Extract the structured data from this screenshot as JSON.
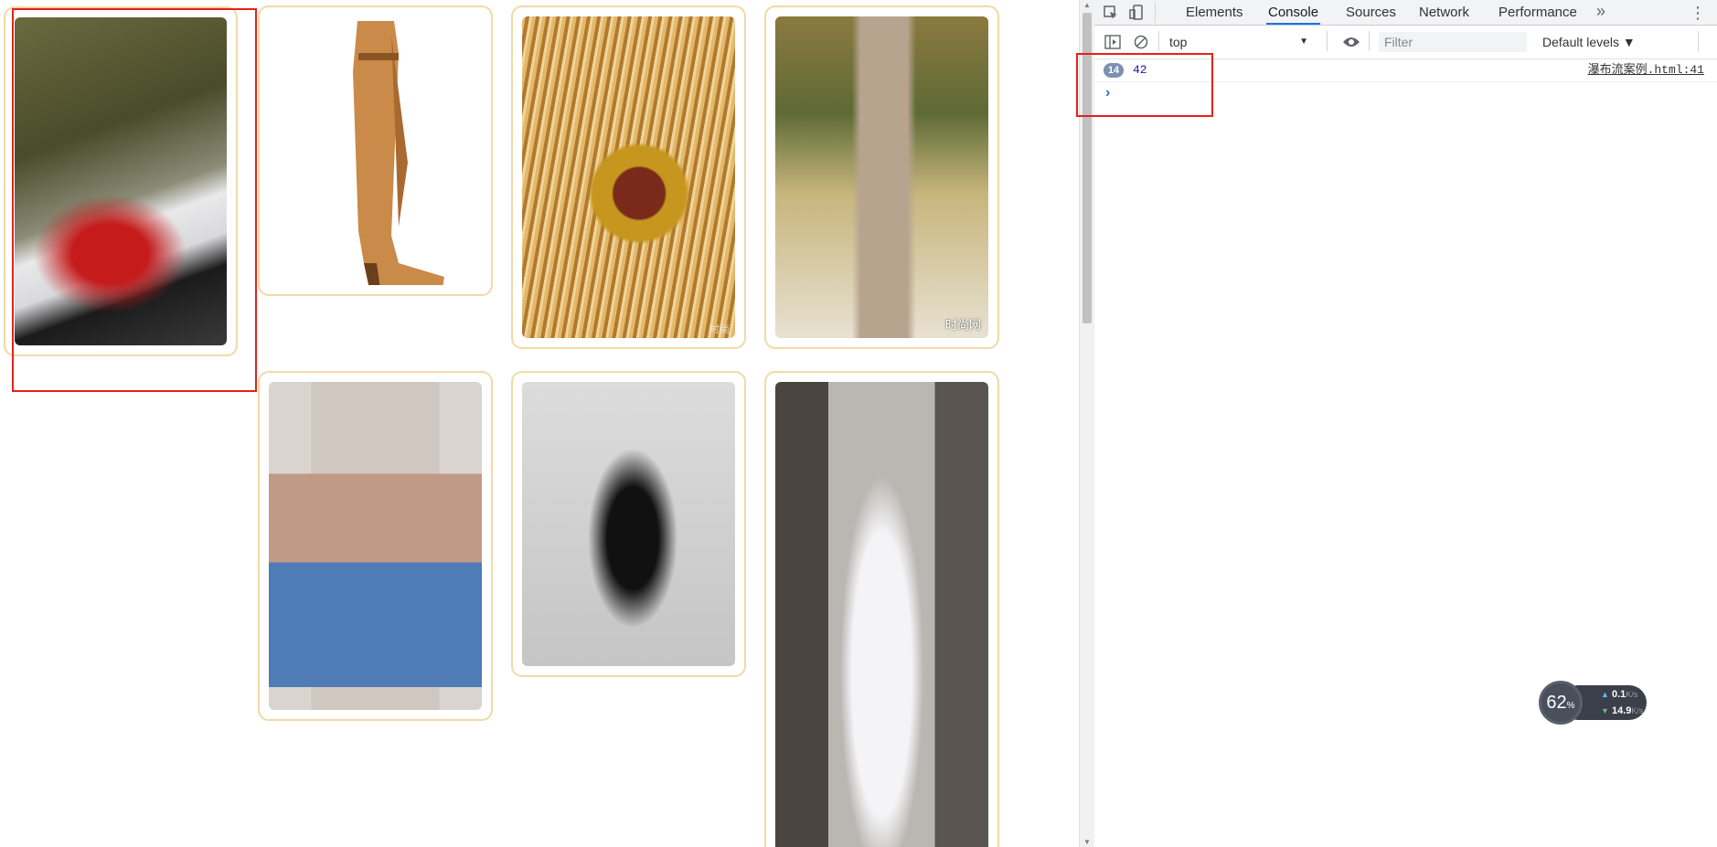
{
  "page": {
    "cards": [
      {
        "name": "necklace-photo",
        "watermark": ""
      },
      {
        "name": "boot-photo",
        "watermark": ""
      },
      {
        "name": "fringe-bag-photo",
        "watermark": "时尚"
      },
      {
        "name": "runway-dress-photo",
        "watermark": "时尚网"
      },
      {
        "name": "poncho-jeans-photo",
        "watermark": ""
      },
      {
        "name": "black-gown-photo",
        "watermark": ""
      },
      {
        "name": "white-dress-photo",
        "watermark": ""
      }
    ]
  },
  "devtools": {
    "tabs": [
      "Elements",
      "Console",
      "Sources",
      "Network",
      "Performance"
    ],
    "active_tab": "Console",
    "more_tabs_icon": "chevron-double-right-icon",
    "context": "top",
    "filter_placeholder": "Filter",
    "levels": "Default levels ▼",
    "logs": [
      {
        "count": "14",
        "value": "42",
        "source": "瀑布流案例.html:41"
      }
    ],
    "prompt": "›"
  },
  "speed_widget": {
    "percent": "62",
    "percent_unit": "%",
    "upload": "0.1",
    "download": "14.9",
    "unit": "K/s"
  },
  "colors": {
    "card_border": "#f2d9a6",
    "highlight": "#e8201c",
    "active_tab_underline": "#1a73e8",
    "badge": "#7d8fb3"
  }
}
